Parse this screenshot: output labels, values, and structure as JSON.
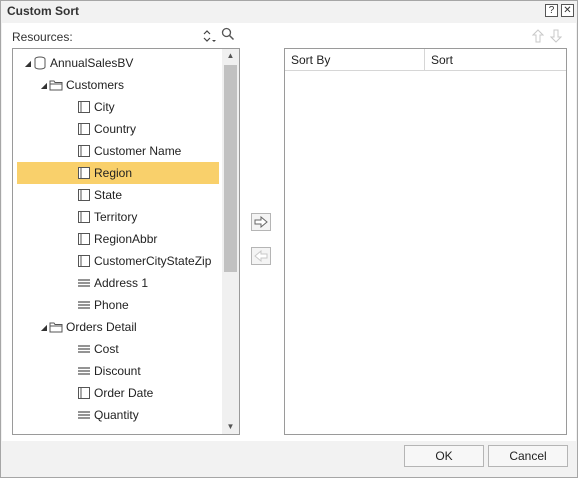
{
  "dialog": {
    "title": "Custom Sort",
    "help_label": "?",
    "close_label": "✕"
  },
  "resources": {
    "label": "Resources:",
    "tree": [
      {
        "label": "AnnualSalesBV",
        "icon": "database-icon",
        "expander": "expanded"
      },
      {
        "label": "Customers",
        "icon": "folder-icon",
        "expander": "expanded"
      },
      {
        "label": "City",
        "icon": "dimension-icon"
      },
      {
        "label": "Country",
        "icon": "dimension-icon"
      },
      {
        "label": "Customer Name",
        "icon": "dimension-icon"
      },
      {
        "label": "Region",
        "icon": "dimension-icon",
        "selected": true
      },
      {
        "label": "State",
        "icon": "dimension-icon"
      },
      {
        "label": "Territory",
        "icon": "dimension-icon"
      },
      {
        "label": "RegionAbbr",
        "icon": "dimension-icon"
      },
      {
        "label": "CustomerCityStateZip",
        "icon": "dimension-icon"
      },
      {
        "label": "Address 1",
        "icon": "field-icon"
      },
      {
        "label": "Phone",
        "icon": "field-icon"
      },
      {
        "label": "Orders Detail",
        "icon": "folder-icon",
        "expander": "expanded"
      },
      {
        "label": "Cost",
        "icon": "field-icon"
      },
      {
        "label": "Discount",
        "icon": "field-icon"
      },
      {
        "label": "Order Date",
        "icon": "dimension-icon"
      },
      {
        "label": "Quantity",
        "icon": "field-icon"
      }
    ]
  },
  "sort_table": {
    "columns": [
      "Sort By",
      "Sort"
    ],
    "rows": []
  },
  "buttons": {
    "ok": "OK",
    "cancel": "Cancel"
  },
  "colors": {
    "selection": "#f9d06b",
    "border": "#9a9a9a"
  }
}
